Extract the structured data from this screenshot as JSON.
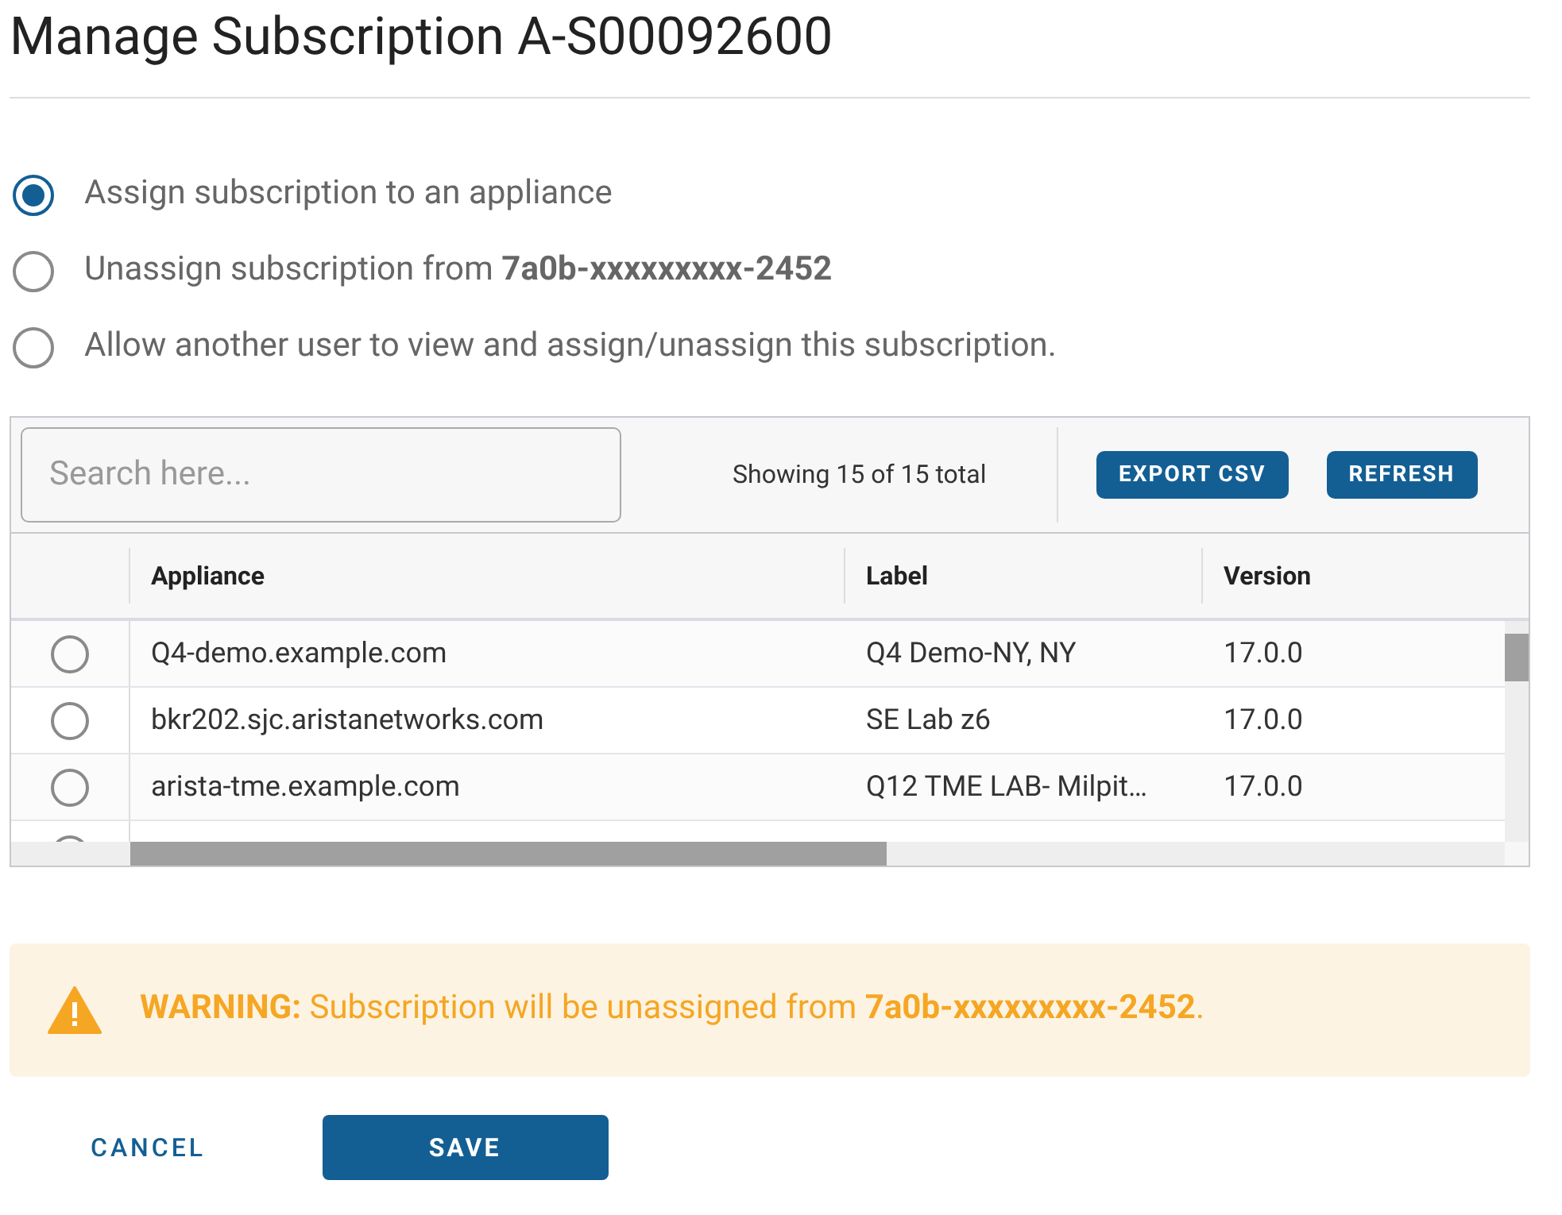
{
  "title": "Manage Subscription A-S00092600",
  "options": [
    {
      "label": "Assign subscription to an appliance",
      "selected": true
    },
    {
      "label": "Unassign subscription from **7a0b-xxxxxxxxx-2452**",
      "selected": false
    },
    {
      "label": "Allow another user to view and assign/unassign this subscription.",
      "selected": false
    }
  ],
  "table": {
    "search": {
      "placeholder": "Search here..."
    },
    "count": "Showing 15 of 15 total",
    "buttons": [
      "EXPORT CSV",
      "REFRESH"
    ],
    "columns": [
      "Appliance",
      "Label",
      "Version"
    ],
    "rows": [
      {
        "selected": false,
        "cells": [
          "Q4-demo.example.com",
          "Q4 Demo-NY, NY",
          "17.0.0"
        ]
      },
      {
        "selected": false,
        "cells": [
          "bkr202.sjc.aristanetworks.com",
          "SE Lab z6",
          "17.0.0"
        ]
      },
      {
        "selected": false,
        "cells": [
          "arista-tme.example.com",
          "Q12 TME LAB- Milpit…",
          "17.0.0"
        ]
      },
      {
        "selected": false
      }
    ]
  },
  "warning": {
    "text": "**WARNING:** Subscription will be unassigned from **7a0b-xxxxxxxxx-2452**."
  },
  "actions": {
    "cancel": "CANCEL",
    "save": "SAVE"
  }
}
